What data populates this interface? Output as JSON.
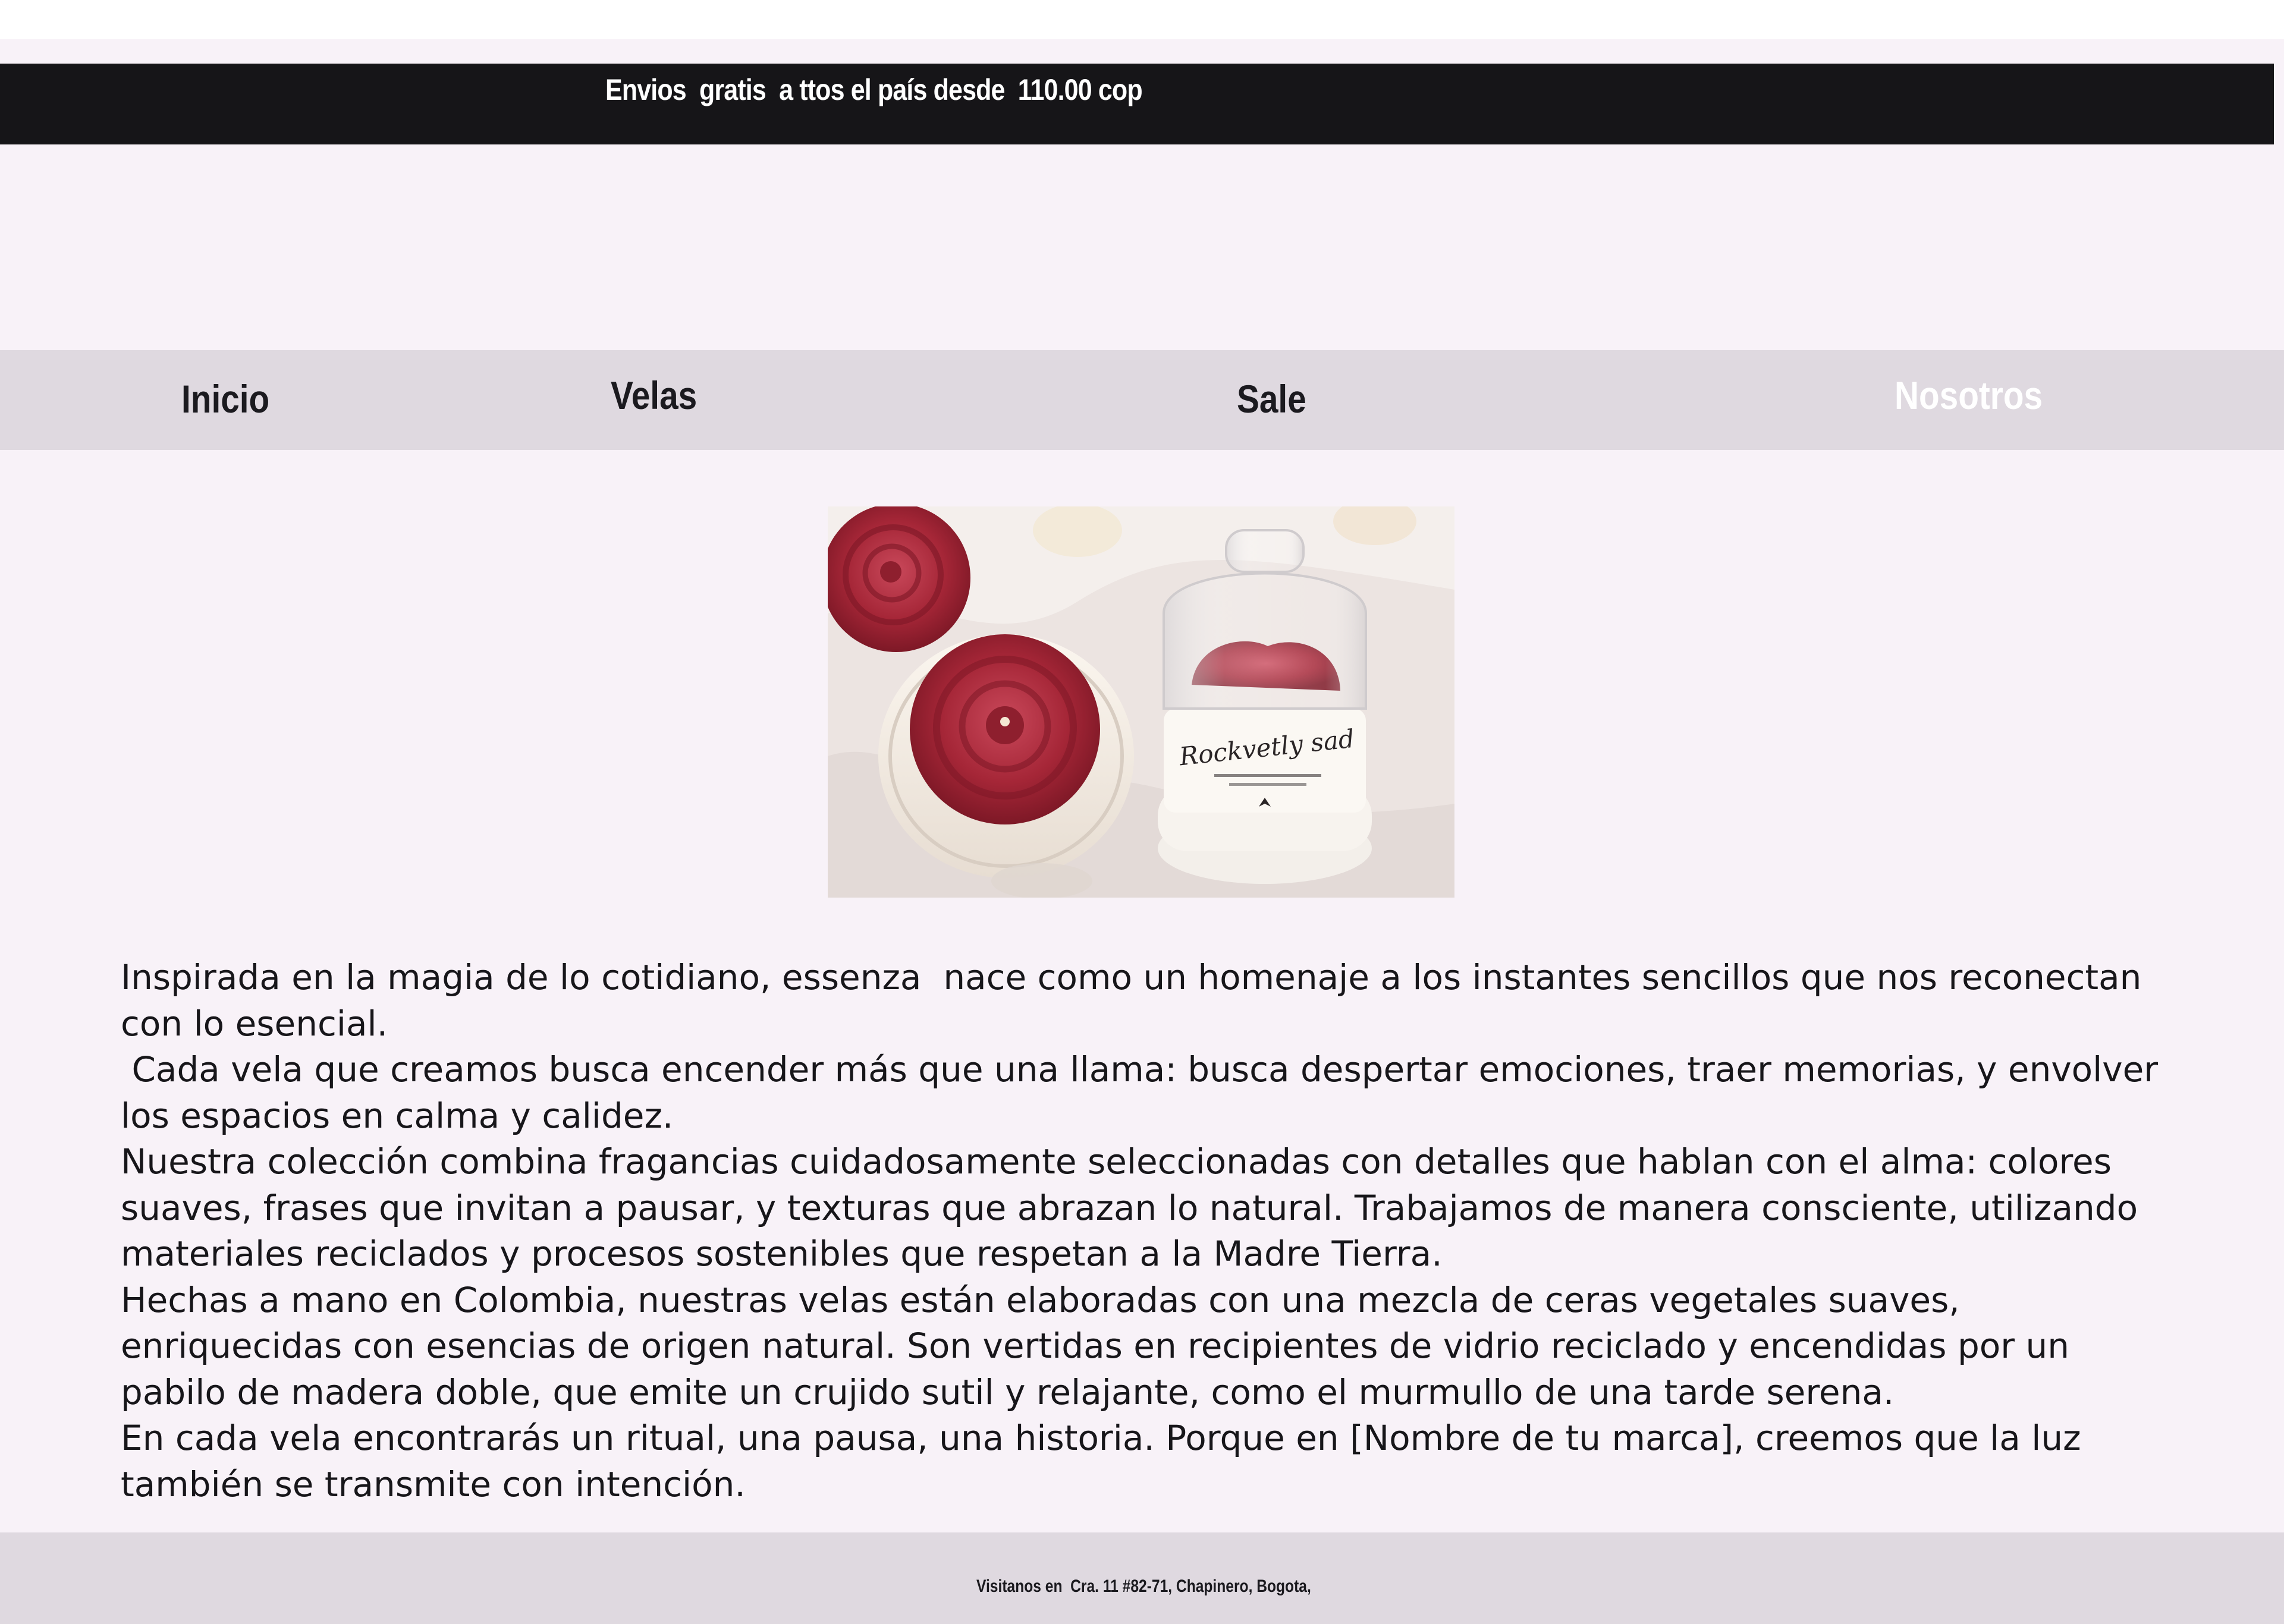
{
  "announcement": {
    "text": "Envios  gratis  a ttos el país desde  110.00 cop"
  },
  "nav": {
    "items": [
      {
        "label": "Inicio"
      },
      {
        "label": "Velas"
      },
      {
        "label": "Sale"
      },
      {
        "label": "Nosotros",
        "active": true
      }
    ]
  },
  "hero": {
    "jar_label": "Rockvetly sad"
  },
  "about": {
    "paragraphs": [
      "Inspirada en la magia de lo cotidiano, essenza  nace como un homenaje a los instantes sencillos que nos reconectan con lo esencial.",
      " Cada vela que creamos busca encender más que una llama: busca despertar emociones, traer memorias, y envolver los espacios en calma y calidez.",
      "Nuestra colección combina fragancias cuidadosamente seleccionadas con detalles que hablan con el alma: colores suaves, frases que invitan a pausar, y texturas que abrazan lo natural. Trabajamos de manera consciente, utilizando materiales reciclados y procesos sostenibles que respetan a la Madre Tierra.",
      "Hechas a mano en Colombia, nuestras velas están elaboradas con una mezcla de ceras vegetales suaves, enriquecidas con esencias de origen natural. Son vertidas en recipientes de vidrio reciclado y encendidas por un pabilo de madera doble, que emite un crujido sutil y relajante, como el murmullo de una tarde serena.",
      "En cada vela encontrarás un ritual, una pausa, una historia. Porque en [Nombre de tu marca], creemos que la luz también se transmite con intención."
    ]
  },
  "footer": {
    "text": "Visitanos en  Cra. 11 #82-71, Chapinero, Bogota,"
  },
  "colors": {
    "page_bg": "#f8f2f8",
    "announcement_bg": "#161518",
    "nav_bg": "#dfd9e0",
    "text": "#17161a",
    "rose_red": "#a8283a"
  }
}
